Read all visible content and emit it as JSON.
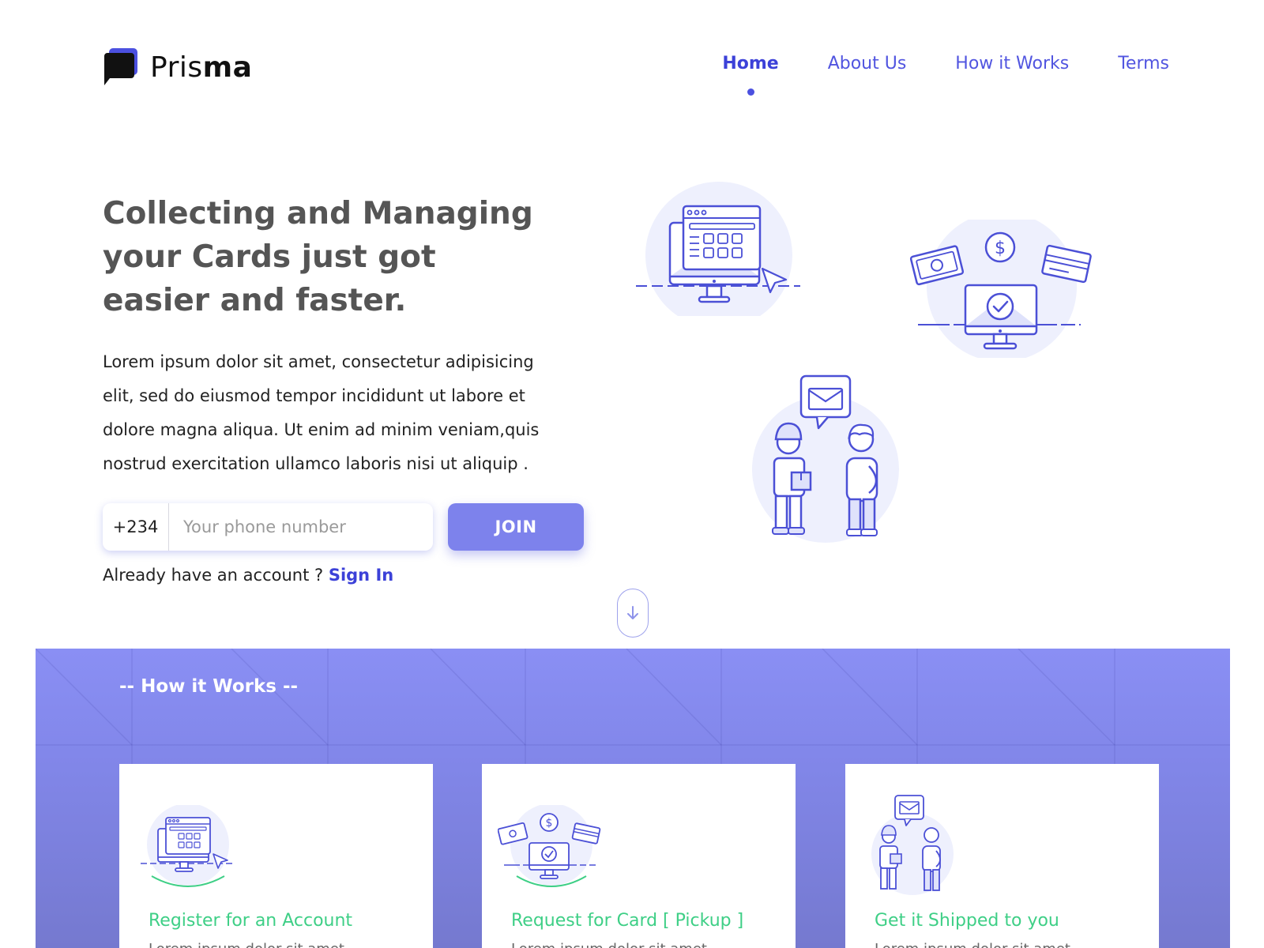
{
  "brand": {
    "name_light": "Pris",
    "name_bold": "ma"
  },
  "nav": {
    "items": [
      {
        "label": "Home",
        "active": true
      },
      {
        "label": "About Us",
        "active": false
      },
      {
        "label": "How it Works",
        "active": false
      },
      {
        "label": "Terms",
        "active": false
      }
    ]
  },
  "hero": {
    "title": "Collecting and Managing your Cards just got easier and faster.",
    "description": "Lorem ipsum dolor sit amet, consectetur adipisicing elit, sed do eiusmod tempor incididunt ut labore et dolore magna aliqua. Ut enim ad minim veniam,quis nostrud exercitation ullamco laboris nisi ut aliquip .",
    "country_code": "+234",
    "phone_placeholder": "Your phone number",
    "join_label": "JOIN",
    "signin_prompt": "Already have an account ?",
    "signin_link": "Sign In"
  },
  "how_it_works": {
    "title": "-- How it Works --",
    "cards": [
      {
        "title": "Register for an Account",
        "text": "Lorem ipsum dolor sit amet",
        "icon": "computer-dashboard-icon"
      },
      {
        "title": "Request for Card [ Pickup ]",
        "text": "Lorem ipsum dolor sit amet",
        "icon": "payment-check-icon"
      },
      {
        "title": "Get it Shipped to you",
        "text": "Lorem ipsum dolor sit amet",
        "icon": "delivery-people-icon"
      }
    ]
  },
  "colors": {
    "primary": "#5155e0",
    "accent_green": "#3ecf86",
    "section_bg": "#8287ea",
    "button": "#7d82ec"
  }
}
